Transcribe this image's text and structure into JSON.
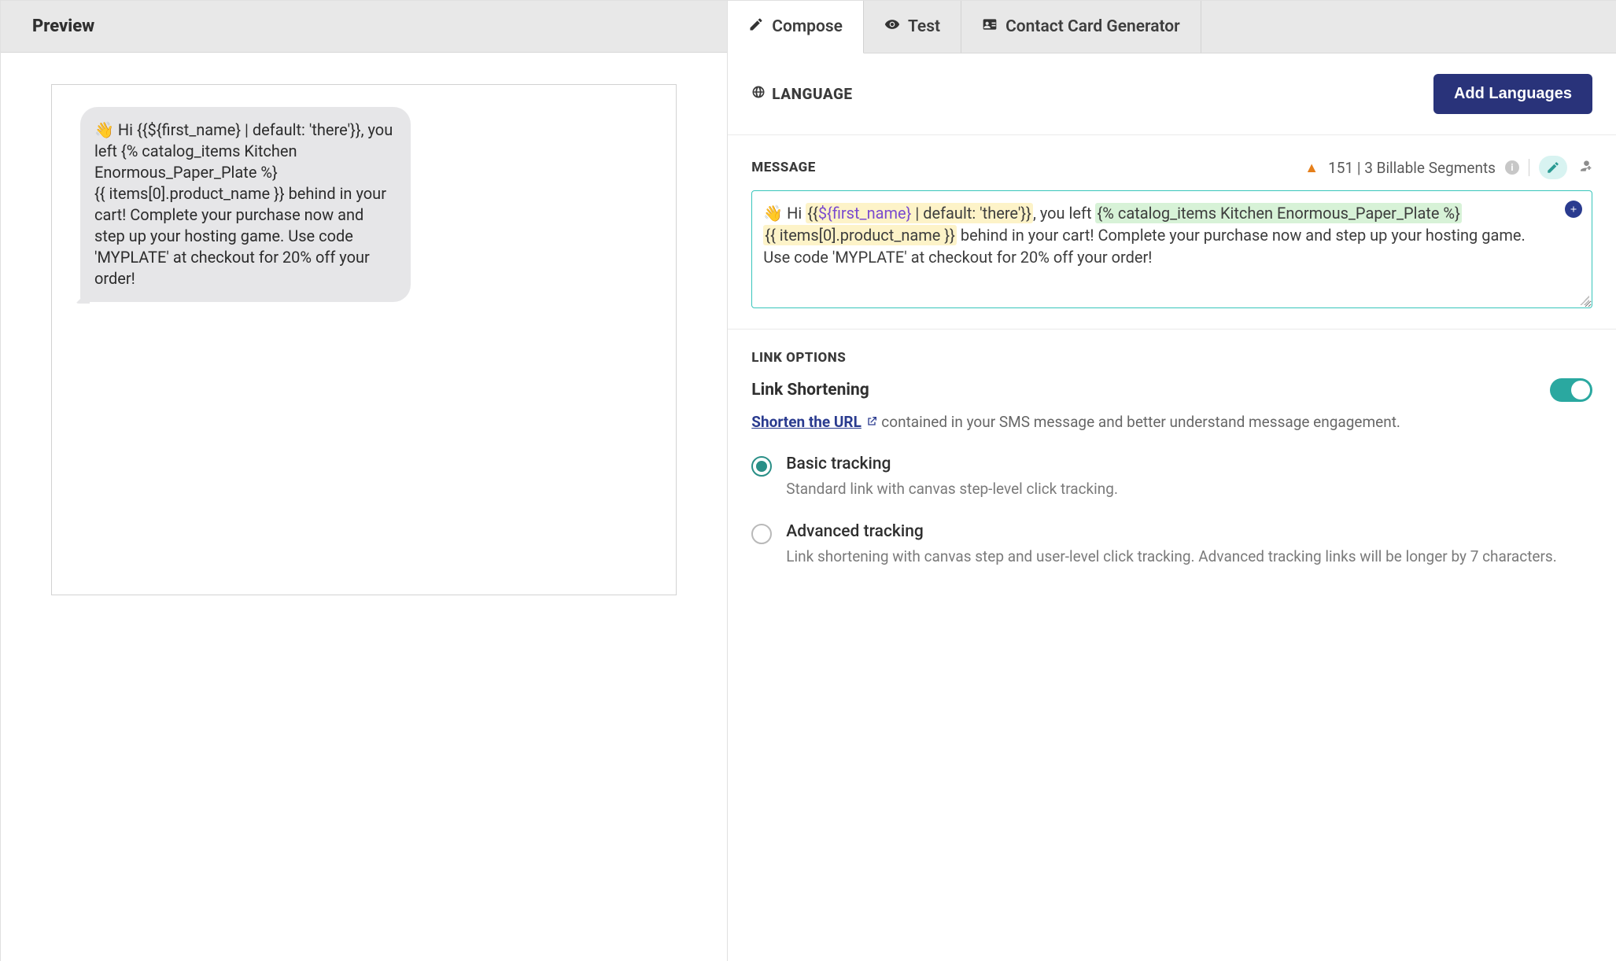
{
  "preview": {
    "title": "Preview",
    "bubble": {
      "emoji": "👋",
      "line1_prefix": " Hi {{${first_name} | default: 'there'}}, you left {% catalog_items Kitchen Enormous_Paper_Plate %}",
      "line2": "{{ items[0].product_name }} behind in your cart! Complete your purchase now and step up your hosting game. Use code 'MYPLATE' at checkout for 20% off your order!"
    }
  },
  "tabs": {
    "compose": "Compose",
    "test": "Test",
    "contact": "Contact Card Generator"
  },
  "language": {
    "label": "LANGUAGE",
    "button": "Add Languages"
  },
  "message": {
    "label": "MESSAGE",
    "count_text": "151 | 3 Billable Segments",
    "body": {
      "emoji": "👋",
      "hi": " Hi ",
      "tok_open": "{{",
      "tok_var": "${first_name}",
      "tok_default": " | default: 'there'",
      "tok_close": "}}",
      "after_name": ", you left ",
      "catalog": "{% catalog_items Kitchen Enormous_Paper_Plate %}",
      "product": "{{ items[0].product_name }}",
      "rest": " behind in your cart! Complete your purchase now and step up your hosting game. Use code 'MYPLATE' at checkout for 20% off your order!"
    }
  },
  "link_options": {
    "heading": "LINK OPTIONS",
    "title": "Link Shortening",
    "toggle_on": true,
    "link_text": "Shorten the URL",
    "desc_after": " contained in your SMS message and better understand message engagement.",
    "radios": {
      "basic": {
        "label": "Basic tracking",
        "sub": "Standard link with canvas step-level click tracking."
      },
      "advanced": {
        "label": "Advanced tracking",
        "sub": "Link shortening with canvas step and user-level click tracking. Advanced tracking links will be longer by 7 characters."
      }
    }
  }
}
